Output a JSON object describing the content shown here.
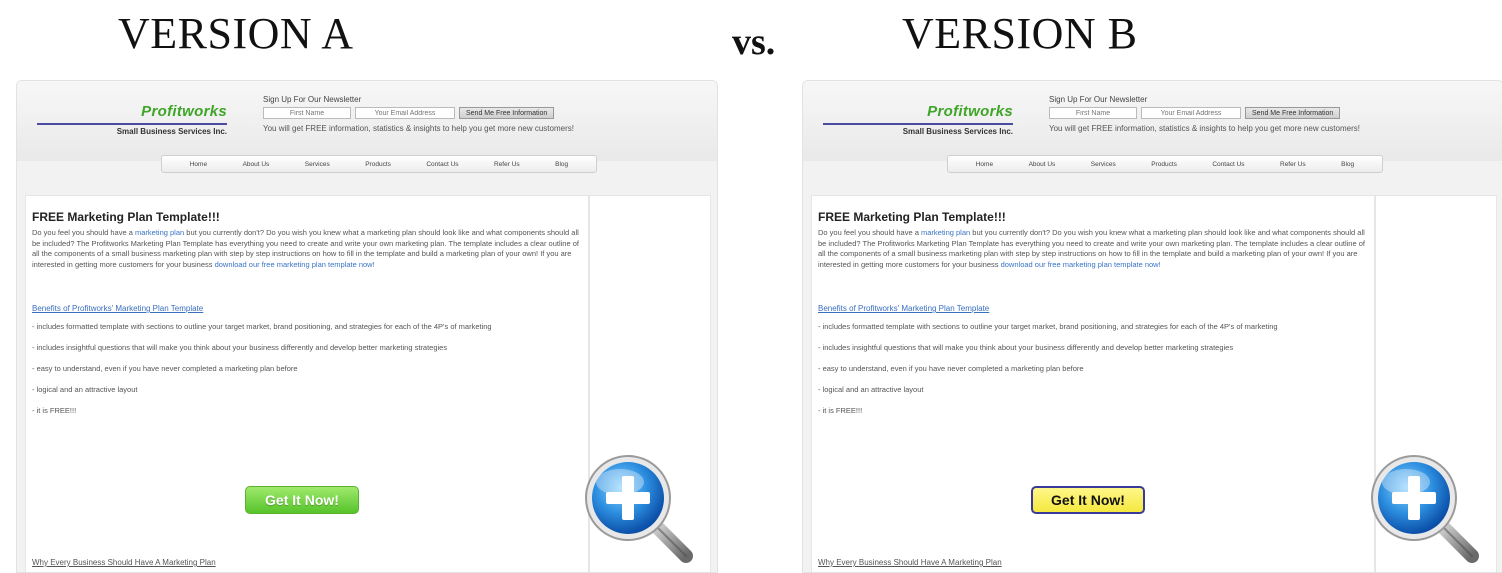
{
  "headings": {
    "version_a": "VERSION A",
    "vs": "vs.",
    "version_b": "VERSION B"
  },
  "site": {
    "logo_name": "Profitworks",
    "logo_sub": "Small Business Services Inc.",
    "newsletter_title": "Sign Up For Our Newsletter",
    "first_name_placeholder": "First Name",
    "email_placeholder": "Your Email Address",
    "submit_label": "Send Me Free Information",
    "newsletter_desc": "You will get FREE information, statistics & insights to help you get more new customers!",
    "nav": [
      "Home",
      "About Us",
      "Services",
      "Products",
      "Contact Us",
      "Refer Us",
      "Blog"
    ],
    "page_title": "FREE Marketing Plan Template!!!",
    "intro_part1": "Do you feel you should have a ",
    "intro_link1": "marketing plan",
    "intro_part2": " but you currently don't? Do you wish you knew what a marketing plan should look like and what components should all be included? The Profitworks Marketing Plan Template has everything you need to create and write your own marketing plan. The template includes a clear outline of all the components of a small business marketing plan with step by step instructions on how to fill in the template and build a marketing plan of your own! If you are interested in getting more customers for your business ",
    "intro_link2": "download our free marketing plan template now!",
    "benefits_title": "Benefits of Profitworks' Marketing Plan Template",
    "bullets": [
      "- includes formatted template with sections to outline your target market, brand positioning, and strategies for each of the 4P's of marketing",
      "- includes insightful questions that will make you think about your business differently and develop better marketing strategies",
      "- easy to understand, even if you have never completed a marketing plan before",
      "- logical and an attractive layout",
      "- it is FREE!!!"
    ],
    "why_title": "Why Every Business Should Have A Marketing Plan"
  },
  "variants": {
    "a": {
      "cta_label": "Get It Now!",
      "cta_color": "#56c32a"
    },
    "b": {
      "cta_label": "Get It Now!",
      "cta_color": "#f5e83e"
    }
  },
  "icons": {
    "zoom": "magnifier-plus-icon"
  }
}
